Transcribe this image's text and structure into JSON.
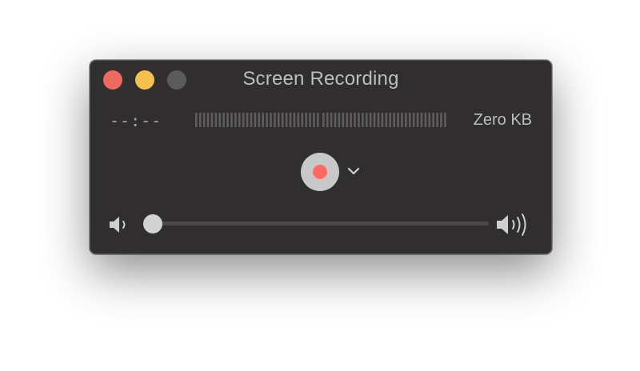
{
  "window": {
    "title": "Screen Recording"
  },
  "recorder": {
    "elapsed_time": "--:--",
    "file_size": "Zero KB",
    "record_icon": "record-icon",
    "options_icon": "chevron-down-icon"
  },
  "volume": {
    "level": 0,
    "low_icon": "speaker-low-icon",
    "high_icon": "speaker-high-icon"
  },
  "colors": {
    "window_bg": "#302e2e",
    "close": "#ed6a5e",
    "minimize": "#f4c04e",
    "maximize_disabled": "#5b5b5b",
    "record_dot": "#ff6b62",
    "record_button": "#c8c8c8",
    "text": "#bdbdbd"
  }
}
